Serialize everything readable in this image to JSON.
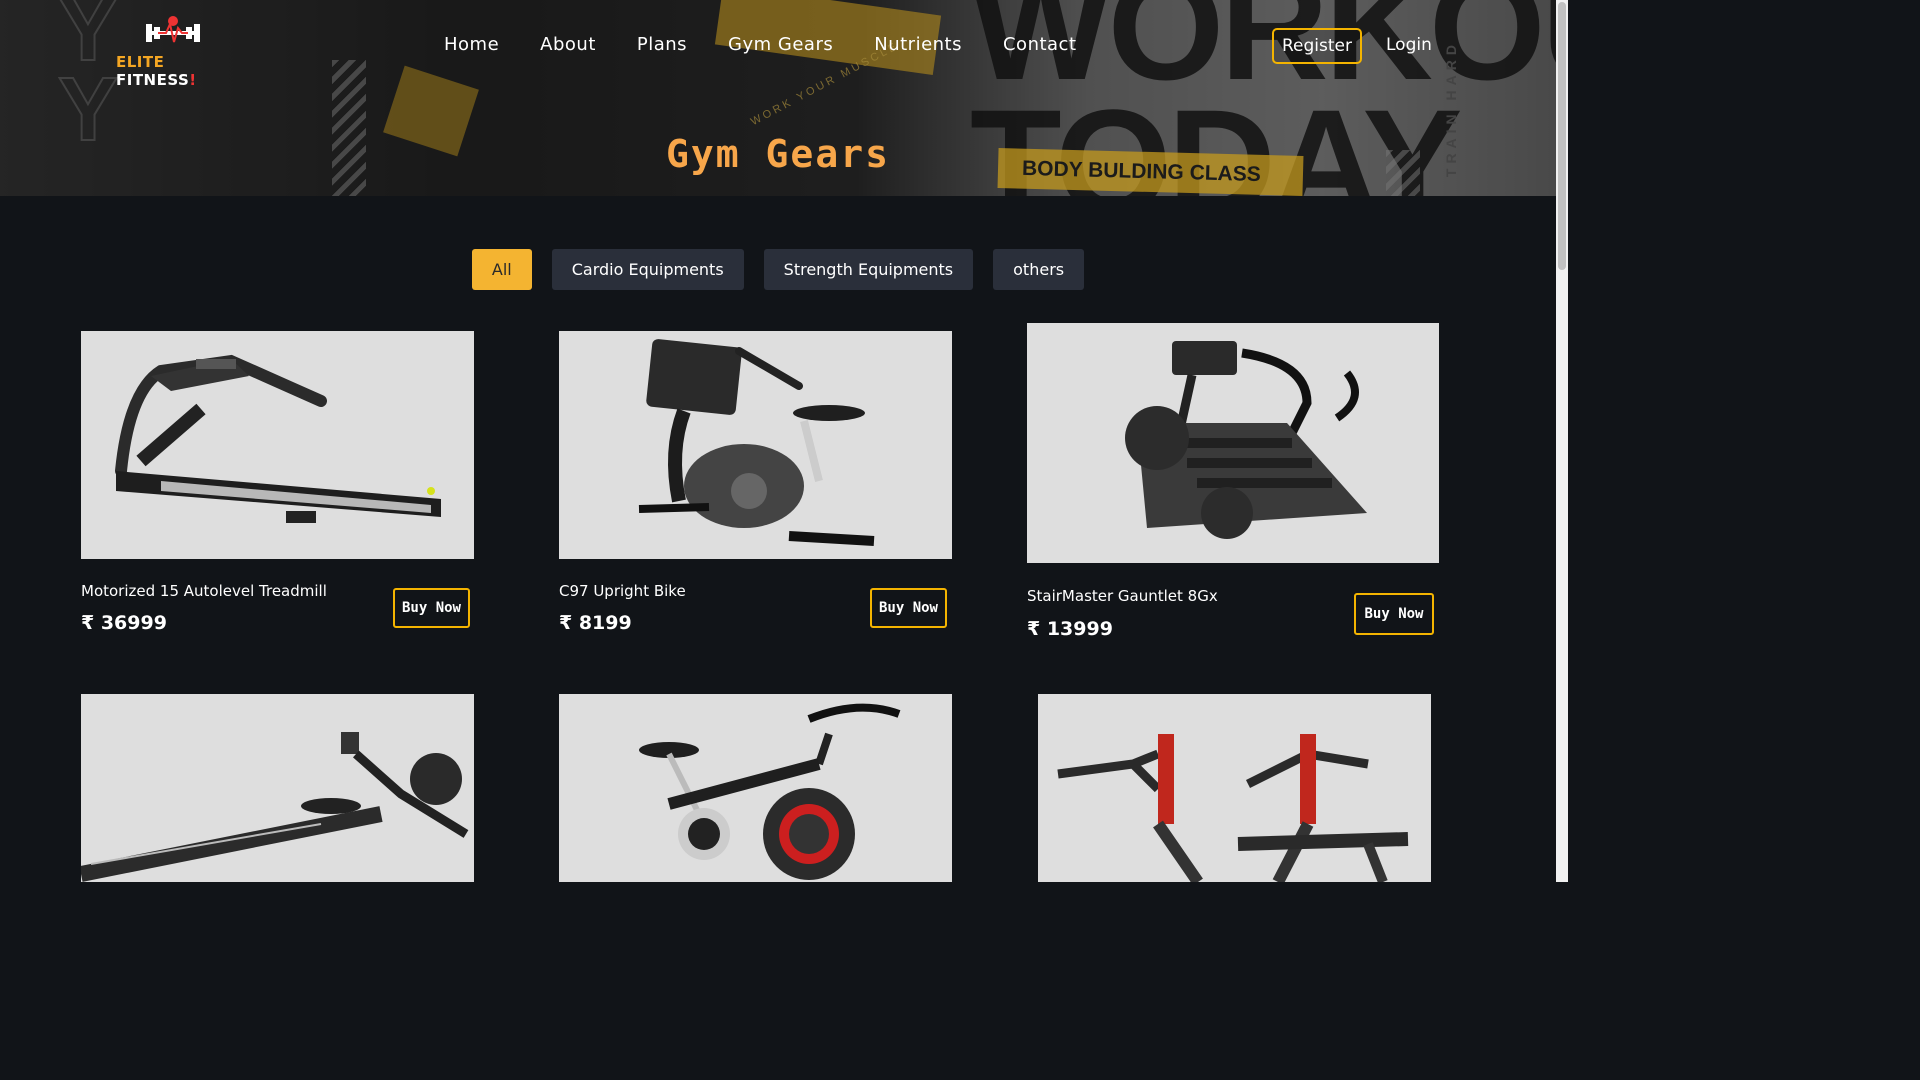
{
  "header": {
    "logo": {
      "word1": "ELITE",
      "word2": "FITNESS",
      "suffix": "!"
    },
    "nav": [
      "Home",
      "About",
      "Plans",
      "Gym Gears",
      "Nutrients",
      "Contact"
    ],
    "register_label": "Register",
    "login_label": "Login",
    "banner_text": {
      "big": "WORKOUT TODAY",
      "band": "BODY BULDING CLASS",
      "vertical": "TRAIN HARD",
      "circular": "WORK YOUR MUSCLE"
    }
  },
  "page_title": "Gym Gears",
  "filters": [
    {
      "label": "All",
      "active": true
    },
    {
      "label": "Cardio Equipments",
      "active": false
    },
    {
      "label": "Strength Equipments",
      "active": false
    },
    {
      "label": "others",
      "active": false
    }
  ],
  "products": [
    {
      "name": "Motorized 15 Autolevel Treadmill",
      "price": "₹ 36999",
      "button": "Buy Now",
      "icon": "treadmill-icon"
    },
    {
      "name": "C97 Upright Bike",
      "price": "₹ 8199",
      "button": "Buy Now",
      "icon": "upright-bike-icon"
    },
    {
      "name": "StairMaster Gauntlet 8Gx",
      "price": "₹ 13999",
      "button": "Buy Now",
      "icon": "stair-climber-icon"
    },
    {
      "icon": "rowing-machine-icon"
    },
    {
      "icon": "spin-bike-icon"
    },
    {
      "icon": "weight-bench-icon"
    }
  ],
  "colors": {
    "accent": "#f4b400",
    "title": "#f7a64a",
    "background": "#111418",
    "filter_bg": "#2a2f3a",
    "filter_active": "#f4b431"
  }
}
